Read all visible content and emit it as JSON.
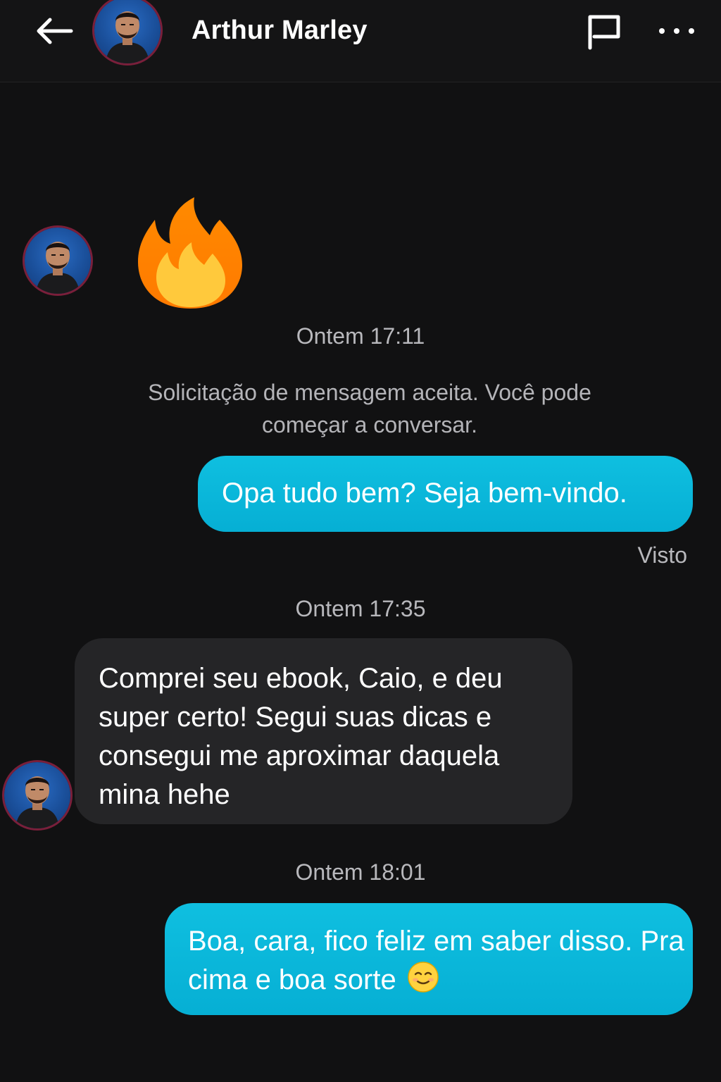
{
  "header": {
    "name": "Arthur Marley",
    "icons": [
      "back-arrow-icon",
      "flag-icon",
      "more-icon"
    ]
  },
  "messages": {
    "reaction_emoji": "fire",
    "timestamp_1": "Ontem 17:11",
    "system_text": "Solicitação de mensagem aceita. Você pode começar a conversar.",
    "out_1": "Opa tudo bem? Seja bem-vindo.",
    "seen_label": "Visto",
    "timestamp_2": "Ontem 17:35",
    "in_1": "Comprei seu ebook, Caio, e deu super certo! Segui suas dicas e consegui me aproximar daquela mina hehe",
    "timestamp_3": "Ontem 18:01",
    "out_2": "Boa, cara, fico feliz em saber disso. Pra cima e boa sorte",
    "out_2_emoji": "smiling-face"
  },
  "colors": {
    "background": "#111112",
    "outgoing_bubble": "#0cb8dc",
    "incoming_bubble": "#252527",
    "muted_text": "#b8b8bc"
  }
}
